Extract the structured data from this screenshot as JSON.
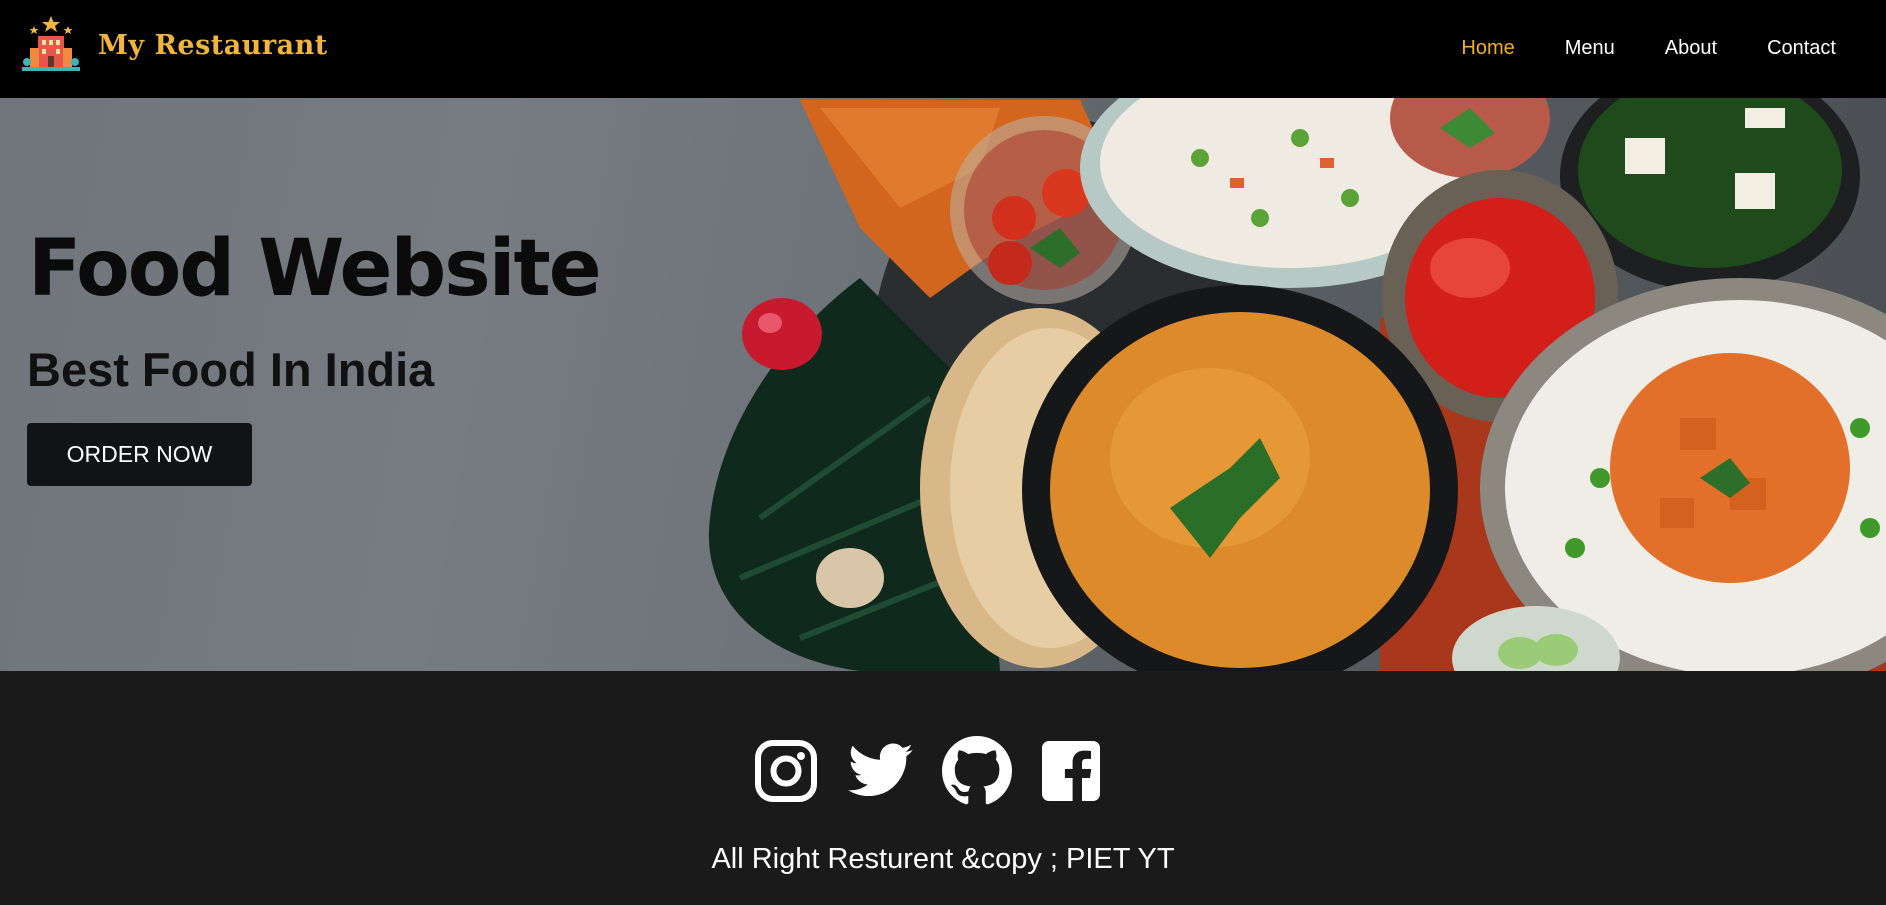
{
  "brand": {
    "name": "My Restaurant",
    "accent_color": "#f2b53c",
    "logo_icon": "restaurant-building-icon"
  },
  "nav": {
    "items": [
      {
        "label": "Home",
        "active": true
      },
      {
        "label": "Menu",
        "active": false
      },
      {
        "label": "About",
        "active": false
      },
      {
        "label": "Contact",
        "active": false
      }
    ],
    "active_color": "#f2ad27"
  },
  "hero": {
    "title": "Food Website",
    "subtitle": "Best Food In India",
    "cta_label": "ORDER NOW",
    "image": "indian-food-spread-photo"
  },
  "footer": {
    "social_icons": [
      "instagram-icon",
      "twitter-icon",
      "github-icon",
      "facebook-icon"
    ],
    "copyright": "All Right Resturent &copy ; PIET YT"
  },
  "colors": {
    "header_bg": "#000000",
    "footer_bg": "#1a1a1a",
    "button_bg": "#111417"
  }
}
